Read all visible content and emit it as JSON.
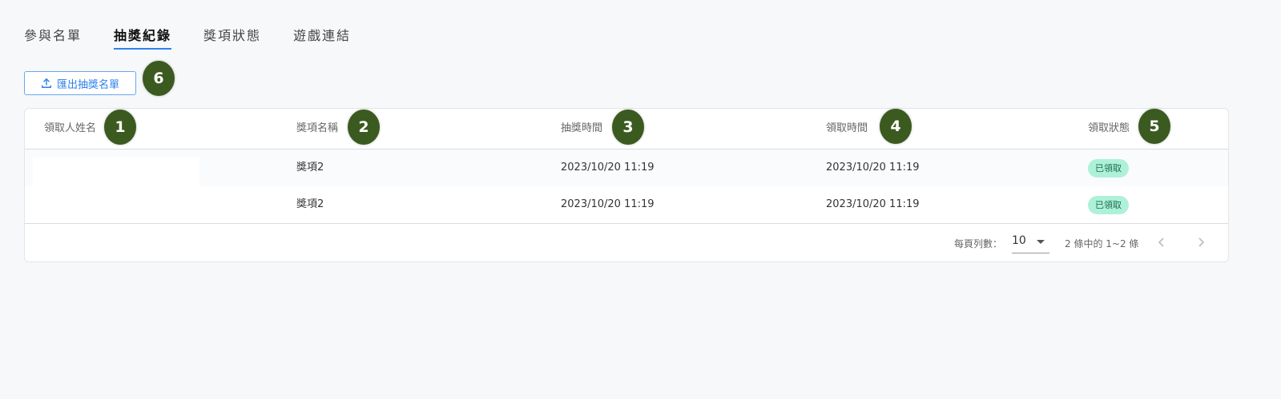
{
  "tabs": [
    {
      "label": "參與名單",
      "active": false
    },
    {
      "label": "抽獎紀錄",
      "active": true
    },
    {
      "label": "獎項狀態",
      "active": false
    },
    {
      "label": "遊戲連結",
      "active": false
    }
  ],
  "export_button": {
    "label": "匯出抽獎名單",
    "icon": "upload-icon"
  },
  "table": {
    "columns": [
      "領取人姓名",
      "獎項名稱",
      "抽獎時間",
      "領取時間",
      "領取狀態"
    ],
    "rows": [
      {
        "name": "",
        "prize": "獎項2",
        "draw_time": "2023/10/20 11:19",
        "claim_time": "2023/10/20 11:19",
        "status": "已領取"
      },
      {
        "name": "",
        "prize": "獎項2",
        "draw_time": "2023/10/20 11:19",
        "claim_time": "2023/10/20 11:19",
        "status": "已領取"
      }
    ]
  },
  "pagination": {
    "rows_per_page_label": "每頁列數：",
    "rows_per_page": "10",
    "range_text": "2 條中的 1~2 條",
    "prev_icon": "chevron-left-icon",
    "next_icon": "chevron-right-icon"
  },
  "annotations": [
    "1",
    "2",
    "3",
    "4",
    "5",
    "6"
  ],
  "colors": {
    "accent": "#2f80ed",
    "badge": "#3b5a1f",
    "status_bg": "#aef1d9"
  }
}
